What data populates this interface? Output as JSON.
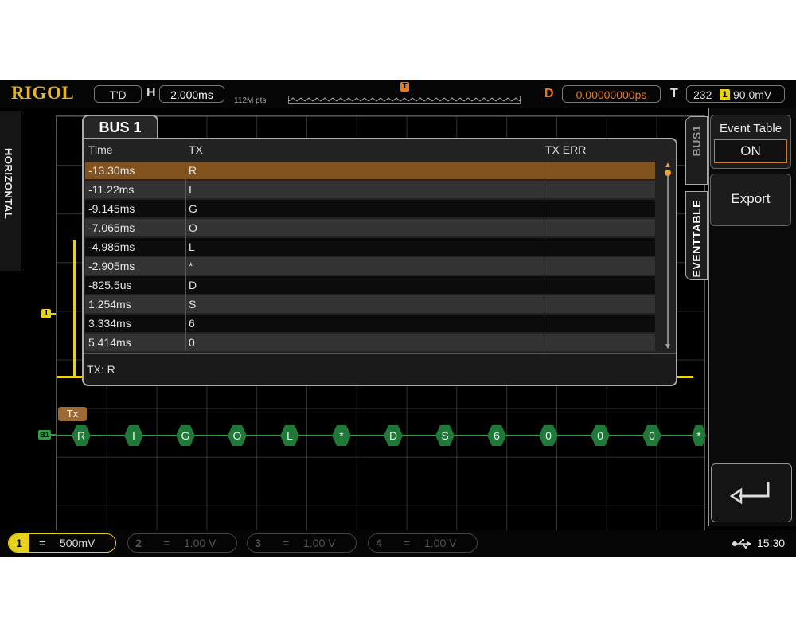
{
  "topbar": {
    "brand": "RIGOL",
    "run_status": "T'D",
    "horizontal_label": "H",
    "timebase": "2.000ms",
    "memory_depth": "112M pts",
    "delay_label": "D",
    "delay_value": "0.00000000ps",
    "trigger_label": "T",
    "trigger_level_num": "232",
    "trigger_source": "1",
    "trigger_level": "90.0mV"
  },
  "left_tab": {
    "label": "HORIZONTAL"
  },
  "bus_window": {
    "tab_title": "BUS 1",
    "columns": [
      "Time",
      "TX",
      "TX ERR"
    ],
    "rows": [
      {
        "time": "-13.30ms",
        "tx": "R"
      },
      {
        "time": "-11.22ms",
        "tx": "I"
      },
      {
        "time": "-9.145ms",
        "tx": "G"
      },
      {
        "time": "-7.065ms",
        "tx": "O"
      },
      {
        "time": "-4.985ms",
        "tx": "L"
      },
      {
        "time": "-2.905ms",
        "tx": "*"
      },
      {
        "time": "-825.5us",
        "tx": "D"
      },
      {
        "time": "1.254ms",
        "tx": "S"
      },
      {
        "time": "3.334ms",
        "tx": "6"
      },
      {
        "time": "5.414ms",
        "tx": "0"
      }
    ],
    "detail": "TX: R"
  },
  "right_tabs": {
    "bus": "BUS1",
    "event_table": "EVENTTABLE"
  },
  "right_menu": {
    "event_table_label": "Event Table",
    "event_table_state": "ON",
    "export_label": "Export",
    "back_icon": "return-arrow-icon"
  },
  "markers": {
    "channel1": "1",
    "bus1": "B1"
  },
  "decode": {
    "tag": "Tx",
    "symbols": [
      "R",
      "I",
      "G",
      "O",
      "L",
      "*",
      "D",
      "S",
      "6",
      "0",
      "0",
      "0",
      "*"
    ]
  },
  "bottombar": {
    "channels": [
      {
        "num": "1",
        "coupling": "=",
        "scale": "500mV",
        "active": true
      },
      {
        "num": "2",
        "coupling": "=",
        "scale": "1.00 V",
        "active": false
      },
      {
        "num": "3",
        "coupling": "=",
        "scale": "1.00 V",
        "active": false
      },
      {
        "num": "4",
        "coupling": "=",
        "scale": "1.00 V",
        "active": false
      }
    ],
    "usb_icon": "usb-icon",
    "time": "15:30"
  },
  "colors": {
    "brand": "#e8b52a",
    "channel1": "#e6d21a",
    "selected_row": "#83531e",
    "decode": "#1f7a3a",
    "trigger_marker": "#e87b1e"
  }
}
